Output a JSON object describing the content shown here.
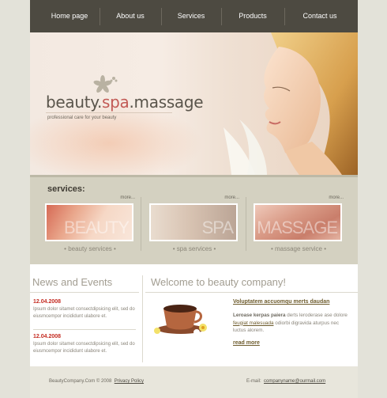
{
  "nav": {
    "items": [
      {
        "label": "Home page"
      },
      {
        "label": "About us"
      },
      {
        "label": "Services"
      },
      {
        "label": "Products"
      },
      {
        "label": "Contact us"
      }
    ]
  },
  "hero": {
    "brand_part1": "beauty.",
    "brand_part2": "spa",
    "brand_part3": ".massage",
    "tagline": "professional care for your beauty"
  },
  "services": {
    "title": "services:",
    "items": [
      {
        "more": "more...",
        "caption": "• beauty services •",
        "thumb_word": "BEAUTY"
      },
      {
        "more": "more...",
        "caption": "• spa services •",
        "thumb_word": "SPA"
      },
      {
        "more": "more...",
        "caption": "• massage service •",
        "thumb_word": "MASSAGE"
      }
    ]
  },
  "news": {
    "title": "News and Events",
    "items": [
      {
        "date": "12.04.2008",
        "text": "Ipsum dolor sitamet consectdipsicing elit, sed do eiusmcempor incididunt ulabore et."
      },
      {
        "date": "12.04.2008",
        "text": "Ipsum dolor sitamet consectdipsicing elit, sed do eiusmcempor incididunt ulabore et."
      }
    ]
  },
  "welcome": {
    "title": "Welcome to beauty company!",
    "article_title": "Voluptatem accuomqu merts daudan",
    "article_lead": "Leroase kerpas paiera",
    "article_mid1": " derts leroderase ase dolore ",
    "article_link": "feugiat malesuada",
    "article_mid2": " odiorbi digravida aturpus nec luctus alorem.",
    "read_more": "read more"
  },
  "footer": {
    "copyright": "BeautyCompany.Com © 2008",
    "privacy": "Privacy Policy",
    "email_label": "E-mail:",
    "email": "companyname@ourmail.com"
  },
  "colors": {
    "nav_bg": "#4d4a41",
    "accent_red": "#c42b21",
    "services_bg": "#d4d1c1",
    "link_brown": "#6e5c2d"
  }
}
